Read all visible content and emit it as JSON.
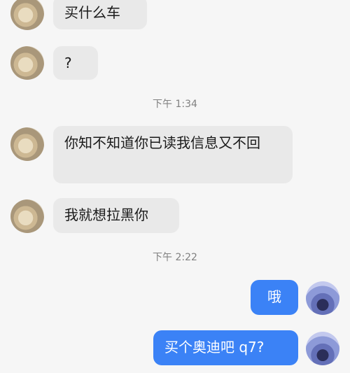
{
  "messages": [
    {
      "sender": "them",
      "text": "买什么车"
    },
    {
      "sender": "them",
      "text": "?"
    },
    {
      "type": "time",
      "text": "下午 1:34"
    },
    {
      "sender": "them",
      "text": "你知不知道你已读我信息又不回"
    },
    {
      "sender": "them",
      "text": "我就想拉黑你"
    },
    {
      "type": "time",
      "text": "下午 2:22"
    },
    {
      "sender": "me",
      "text": "哦"
    },
    {
      "sender": "me",
      "text": "买个奥迪吧 q7?"
    }
  ],
  "colors": {
    "background": "#f6f6f6",
    "incoming_bubble": "#e9e9e9",
    "outgoing_bubble": "#3b82f6",
    "timestamp": "#808080"
  }
}
